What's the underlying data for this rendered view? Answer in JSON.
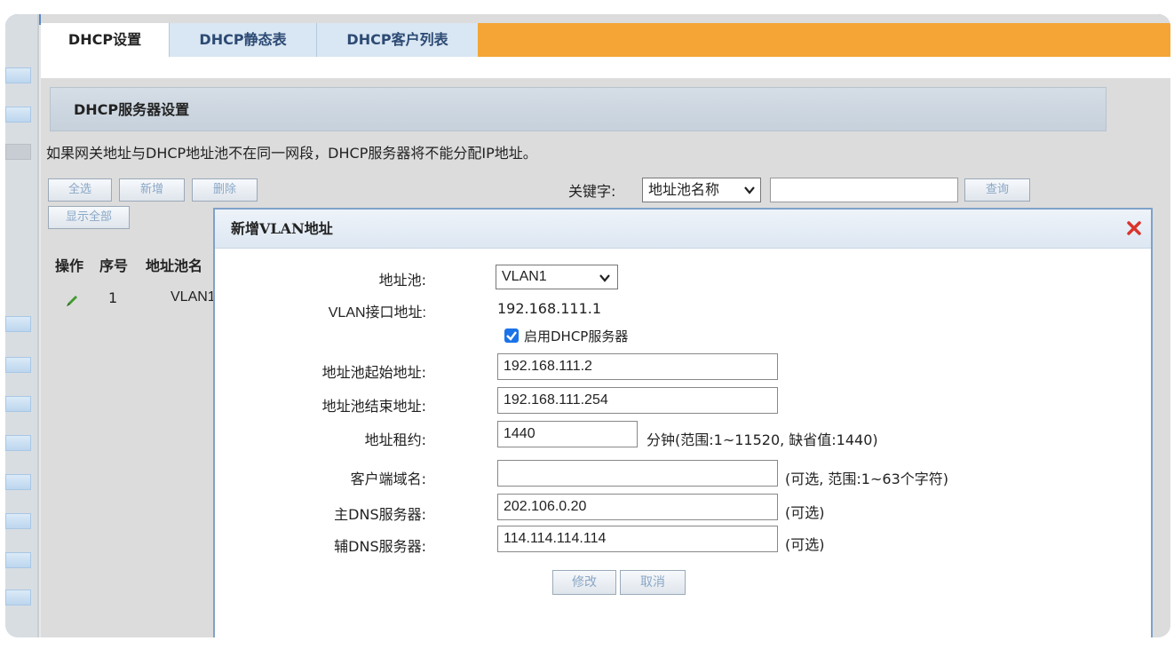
{
  "tabs": [
    {
      "label": "DHCP设置",
      "active": true
    },
    {
      "label": "DHCP静态表",
      "active": false
    },
    {
      "label": "DHCP客户列表",
      "active": false
    }
  ],
  "section_title": "DHCP服务器设置",
  "notice": "如果网关地址与DHCP地址池不在同一网段，DHCP服务器将不能分配IP地址。",
  "toolbar": {
    "select_all": "全选",
    "add": "新增",
    "delete": "删除",
    "show_all": "显示全部",
    "keyword_label": "关键字:",
    "keyword_select": "地址池名称",
    "query": "查询"
  },
  "table": {
    "headers": [
      "操作",
      "序号",
      "地址池名"
    ],
    "rows": [
      {
        "index": "1",
        "name": "VLAN1"
      }
    ]
  },
  "dialog": {
    "title": "新增VLAN地址",
    "fields": {
      "pool_label": "地址池:",
      "pool_value": "VLAN1",
      "vlan_if_label": "VLAN接口地址:",
      "vlan_if_value": "192.168.111.1",
      "enable_dhcp_label": "启用DHCP服务器",
      "start_label": "地址池起始地址:",
      "start_value": "192.168.111.2",
      "end_label": "地址池结束地址:",
      "end_value": "192.168.111.254",
      "lease_label": "地址租约:",
      "lease_value": "1440",
      "lease_hint": "分钟(范围:1~11520, 缺省值:1440)",
      "domain_label": "客户端域名:",
      "domain_value": "",
      "domain_hint": "(可选, 范围:1~63个字符)",
      "dns1_label": "主DNS服务器:",
      "dns1_value": "202.106.0.20",
      "dns1_hint": "(可选)",
      "dns2_label": "辅DNS服务器:",
      "dns2_value": "114.114.114.114",
      "dns2_hint": "(可选)"
    },
    "modify_button": "修改",
    "cancel_button": "取消"
  },
  "colors": {
    "accent_orange": "#f4a536",
    "tab_blue": "#d9e6f3",
    "checkbox_blue": "#1a73e8",
    "close_red": "#d9342b"
  }
}
